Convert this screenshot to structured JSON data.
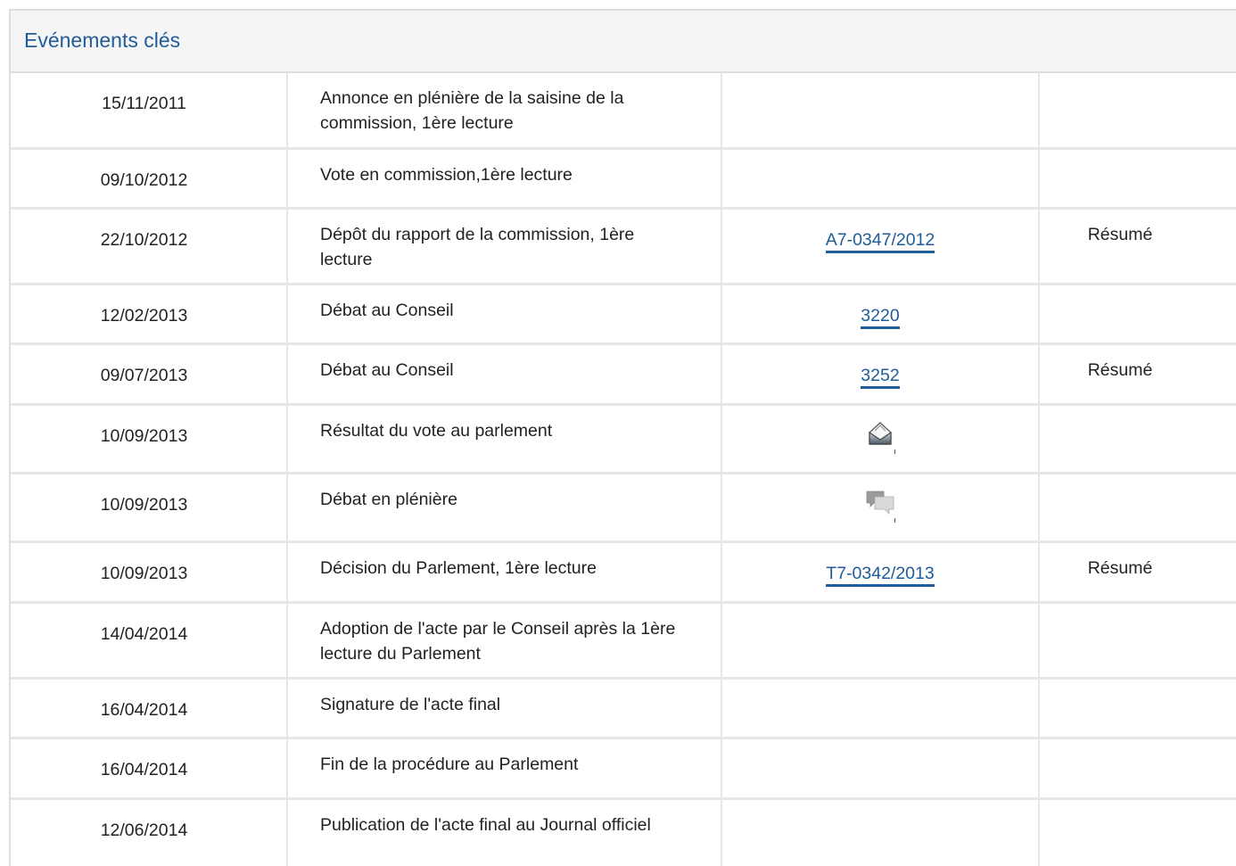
{
  "panel": {
    "title": "Evénements clés"
  },
  "colors": {
    "title": "#1f5c99",
    "link": "#1f5c99",
    "header_bg": "#f5f5f5",
    "border": "#e6e6e6"
  },
  "rows": [
    {
      "date": "15/11/2011",
      "event": "Annonce en plénière de la saisine de la commission, 1ère lecture",
      "doc": "",
      "doc_type": "none",
      "summary": ""
    },
    {
      "date": "09/10/2012",
      "event": "Vote en commission,1ère lecture",
      "doc": "",
      "doc_type": "none",
      "summary": ""
    },
    {
      "date": "22/10/2012",
      "event": "Dépôt du rapport de la commission, 1ère lecture",
      "doc": "A7-0347/2012",
      "doc_type": "link",
      "summary": "Résumé"
    },
    {
      "date": "12/02/2013",
      "event": "Débat au Conseil",
      "doc": "3220",
      "doc_type": "link",
      "summary": ""
    },
    {
      "date": "09/07/2013",
      "event": "Débat au Conseil",
      "doc": "3252",
      "doc_type": "link",
      "summary": "Résumé"
    },
    {
      "date": "10/09/2013",
      "event": "Résultat du vote au parlement",
      "doc": "",
      "doc_type": "vote-icon",
      "summary": ""
    },
    {
      "date": "10/09/2013",
      "event": "Débat en plénière",
      "doc": "",
      "doc_type": "debate-icon",
      "summary": ""
    },
    {
      "date": "10/09/2013",
      "event": "Décision du Parlement, 1ère lecture",
      "doc": "T7-0342/2013",
      "doc_type": "link",
      "summary": "Résumé"
    },
    {
      "date": "14/04/2014",
      "event": "Adoption de l'acte par le Conseil après la 1ère lecture du Parlement",
      "doc": "",
      "doc_type": "none",
      "summary": ""
    },
    {
      "date": "16/04/2014",
      "event": "Signature de l'acte final",
      "doc": "",
      "doc_type": "none",
      "summary": ""
    },
    {
      "date": "16/04/2014",
      "event": "Fin de la procédure au Parlement",
      "doc": "",
      "doc_type": "none",
      "summary": ""
    },
    {
      "date": "12/06/2014",
      "event": "Publication de l'acte final au Journal officiel",
      "doc": "",
      "doc_type": "none",
      "summary": ""
    }
  ]
}
